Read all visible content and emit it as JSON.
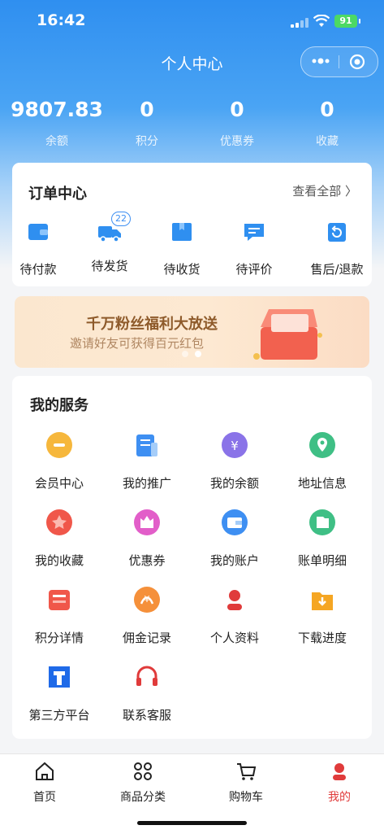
{
  "status_bar": {
    "time": "16:42",
    "battery": "91"
  },
  "nav": {
    "title": "个人中心"
  },
  "stats": [
    {
      "value": "9807.83",
      "label": "余额"
    },
    {
      "value": "0",
      "label": "积分"
    },
    {
      "value": "0",
      "label": "优惠券"
    },
    {
      "value": "0",
      "label": "收藏"
    }
  ],
  "orders": {
    "title": "订单中心",
    "view_all": "查看全部 〉",
    "items": [
      {
        "label": "待付款",
        "icon": "wallet-icon"
      },
      {
        "label": "待发货",
        "icon": "truck-icon",
        "badge": "22"
      },
      {
        "label": "待收货",
        "icon": "box-icon"
      },
      {
        "label": "待评价",
        "icon": "comment-icon"
      },
      {
        "label": "售后/退款",
        "icon": "return-icon"
      }
    ]
  },
  "banner": {
    "title": "千万粉丝福利大放送",
    "subtitle": "邀请好友可获得百元红包"
  },
  "services": {
    "title": "我的服务",
    "items": [
      {
        "label": "会员中心",
        "icon": "member-icon"
      },
      {
        "label": "我的推广",
        "icon": "promotion-icon"
      },
      {
        "label": "我的余额",
        "icon": "balance-icon"
      },
      {
        "label": "地址信息",
        "icon": "location-icon"
      },
      {
        "label": "我的收藏",
        "icon": "favorite-icon"
      },
      {
        "label": "优惠券",
        "icon": "coupon-icon"
      },
      {
        "label": "我的账户",
        "icon": "account-icon"
      },
      {
        "label": "账单明细",
        "icon": "bill-icon"
      },
      {
        "label": "积分详情",
        "icon": "points-icon"
      },
      {
        "label": "佣金记录",
        "icon": "commission-icon"
      },
      {
        "label": "个人资料",
        "icon": "profile-icon"
      },
      {
        "label": "下载进度",
        "icon": "download-icon"
      },
      {
        "label": "第三方平台",
        "icon": "third-party-icon"
      },
      {
        "label": "联系客服",
        "icon": "headset-icon"
      }
    ]
  },
  "tabbar": {
    "items": [
      {
        "label": "首页",
        "icon": "home-icon"
      },
      {
        "label": "商品分类",
        "icon": "category-icon"
      },
      {
        "label": "购物车",
        "icon": "cart-icon"
      },
      {
        "label": "我的",
        "icon": "user-icon",
        "active": true
      }
    ]
  },
  "colors": {
    "primary": "#2f8ff0",
    "active_tab": "#e03b3b"
  }
}
